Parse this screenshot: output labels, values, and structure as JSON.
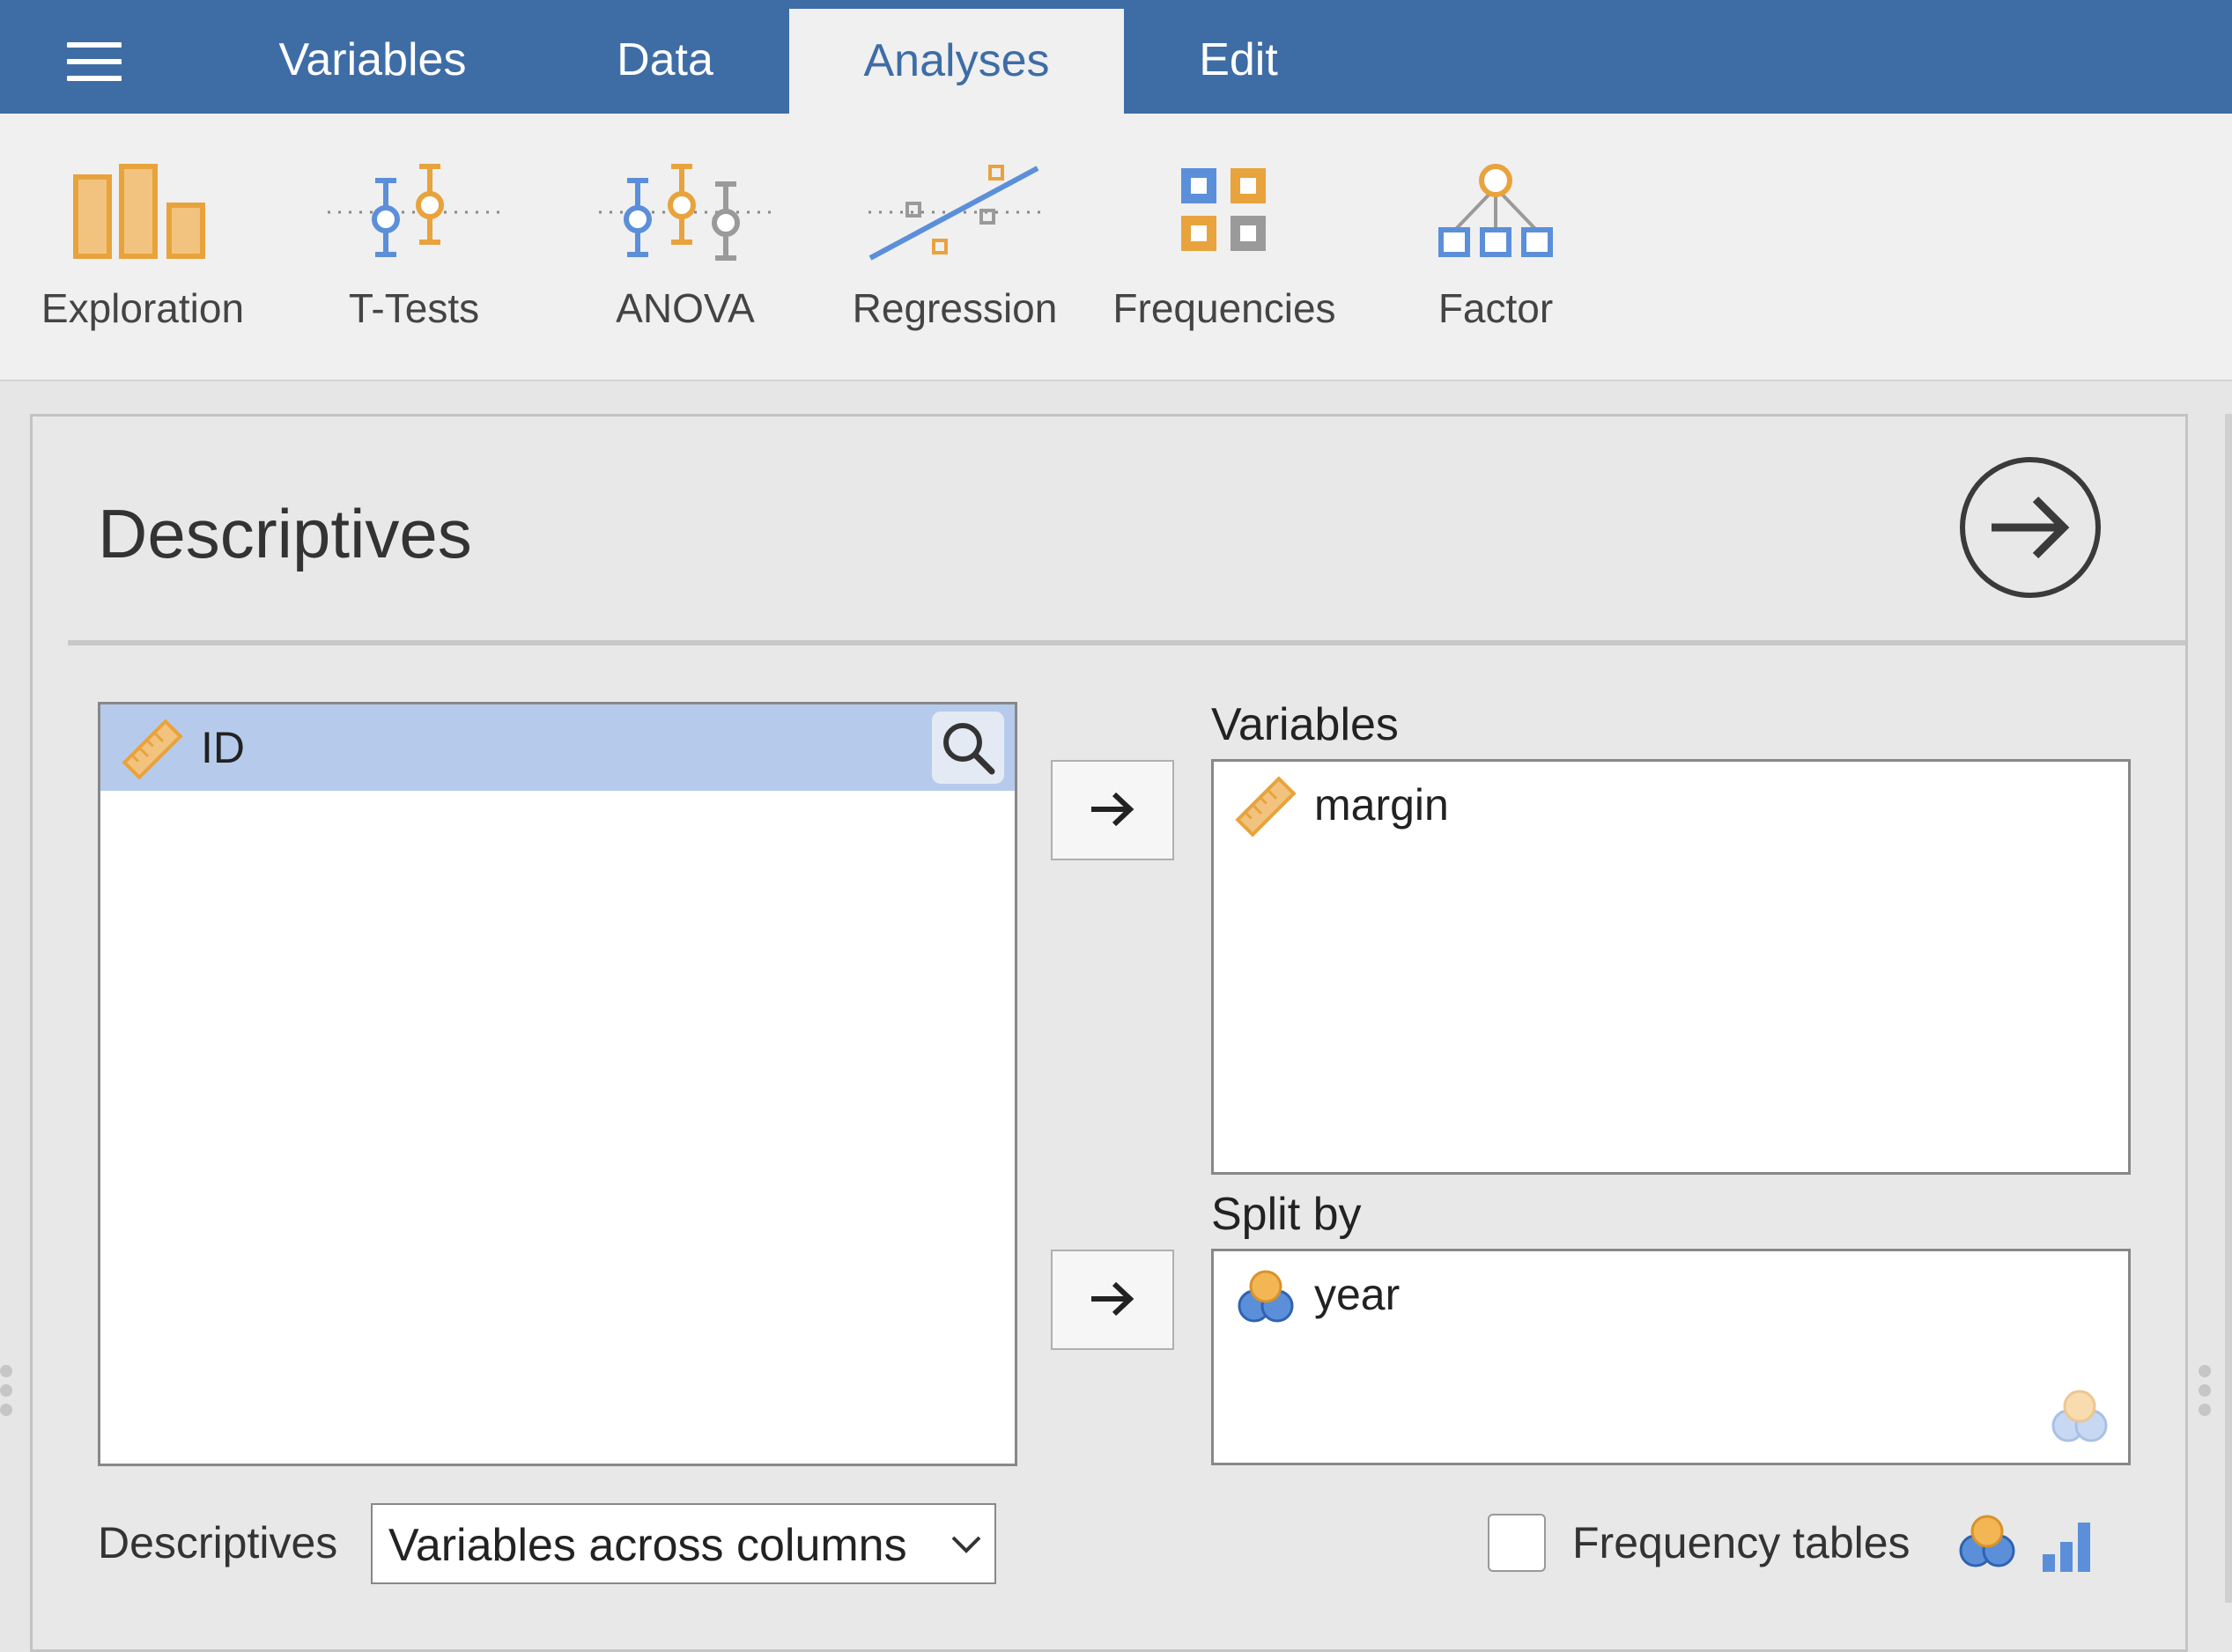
{
  "menu": {
    "tabs": [
      {
        "label": "Variables"
      },
      {
        "label": "Data"
      },
      {
        "label": "Analyses"
      },
      {
        "label": "Edit"
      }
    ],
    "active_tab": "Analyses"
  },
  "ribbon": {
    "items": [
      {
        "label": "Exploration",
        "icon": "exploration-icon"
      },
      {
        "label": "T-Tests",
        "icon": "t-tests-icon"
      },
      {
        "label": "ANOVA",
        "icon": "anova-icon"
      },
      {
        "label": "Regression",
        "icon": "regression-icon"
      },
      {
        "label": "Frequencies",
        "icon": "frequencies-icon"
      },
      {
        "label": "Factor",
        "icon": "factor-icon"
      }
    ]
  },
  "panel": {
    "title": "Descriptives",
    "source_variables": [
      {
        "name": "ID",
        "type_icon": "continuous-ruler-icon",
        "selected": true
      }
    ],
    "variables_label": "Variables",
    "variables": [
      {
        "name": "margin",
        "type_icon": "continuous-ruler-icon"
      }
    ],
    "split_by_label": "Split by",
    "split_by": [
      {
        "name": "year",
        "type_icon": "nominal-circles-icon"
      }
    ],
    "descriptives_label": "Descriptives",
    "descriptives_select_value": "Variables across columns",
    "frequency_tables_label": "Frequency tables",
    "frequency_tables_checked": false
  },
  "colors": {
    "menubar": "#3e6da6",
    "orange": "#e8a33d",
    "blue": "#5b8fd9",
    "gray": "#9a9a9a",
    "selected_row": "#b6cbec"
  }
}
